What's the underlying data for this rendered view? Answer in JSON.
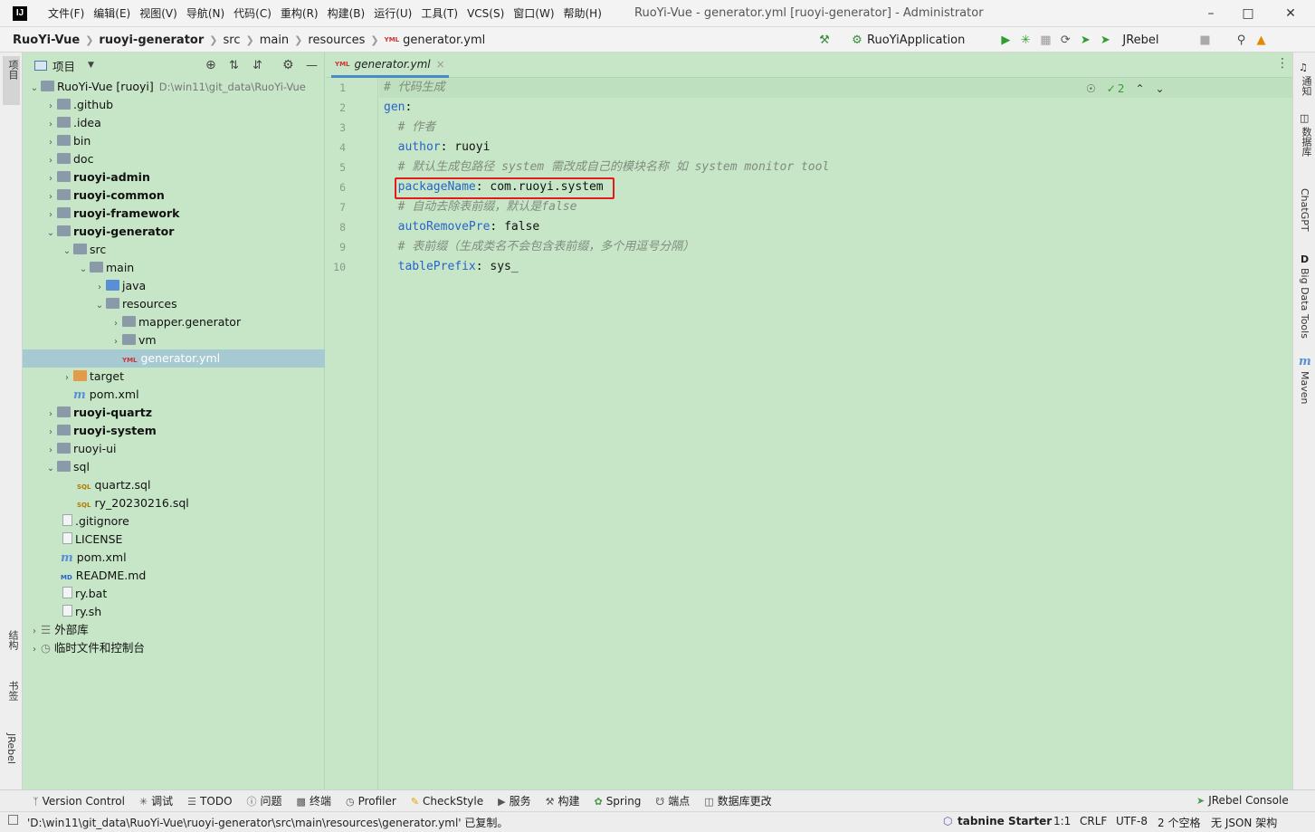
{
  "window": {
    "logo": "IJ",
    "title": "RuoYi-Vue - generator.yml [ruoyi-generator] - Administrator",
    "menu": [
      "文件(F)",
      "编辑(E)",
      "视图(V)",
      "导航(N)",
      "代码(C)",
      "重构(R)",
      "构建(B)",
      "运行(U)",
      "工具(T)",
      "VCS(S)",
      "窗口(W)",
      "帮助(H)"
    ]
  },
  "breadcrumb": [
    "RuoYi-Vue",
    "ruoyi-generator",
    "src",
    "main",
    "resources",
    "generator.yml"
  ],
  "toolbar": {
    "run_config": "RuoYiApplication",
    "jrebel": "JRebel"
  },
  "left_stripe": {
    "top": "项目",
    "structure": "结构",
    "bookmarks": "书签",
    "jrebel": "JRebel"
  },
  "right_stripe": [
    "通知",
    "数据库",
    "ChatGPT",
    "Big Data Tools",
    "Maven"
  ],
  "project_panel": {
    "title": "项目",
    "root_name": "RuoYi-Vue [ruoyi]",
    "root_path": "D:\\win11\\git_data\\RuoYi-Vue",
    "items": [
      ".github",
      ".idea",
      "bin",
      "doc",
      "ruoyi-admin",
      "ruoyi-common",
      "ruoyi-framework",
      "ruoyi-generator",
      "src",
      "main",
      "java",
      "resources",
      "mapper.generator",
      "vm",
      "generator.yml",
      "target",
      "pom.xml",
      "ruoyi-quartz",
      "ruoyi-system",
      "ruoyi-ui",
      "sql",
      "quartz.sql",
      "ry_20230216.sql",
      ".gitignore",
      "LICENSE",
      "pom.xml",
      "README.md",
      "ry.bat",
      "ry.sh",
      "外部库",
      "临时文件和控制台"
    ]
  },
  "editor": {
    "tab": "generator.yml",
    "inspection_count": "2",
    "lines": [
      {
        "n": "1",
        "comment": "# 代码生成"
      },
      {
        "n": "2",
        "key": "gen",
        "sep": ":"
      },
      {
        "n": "3",
        "comment": "  # 作者"
      },
      {
        "n": "4",
        "key": "  author",
        "sep": ": ",
        "value": "ruoyi"
      },
      {
        "n": "5",
        "comment": "  # 默认生成包路径 system 需改成自己的模块名称 如 system monitor tool"
      },
      {
        "n": "6",
        "key": "  packageName",
        "sep": ": ",
        "value": "com.ruoyi.system"
      },
      {
        "n": "7",
        "comment": "  # 自动去除表前缀，默认是false"
      },
      {
        "n": "8",
        "key": "  autoRemovePre",
        "sep": ": ",
        "value": "false"
      },
      {
        "n": "9",
        "comment": "  # 表前缀（生成类名不会包含表前缀，多个用逗号分隔）"
      },
      {
        "n": "10",
        "key": "  tablePrefix",
        "sep": ": ",
        "value": "sys_"
      }
    ]
  },
  "bottom_tools": [
    "Version Control",
    "调试",
    "TODO",
    "问题",
    "终端",
    "Profiler",
    "CheckStyle",
    "服务",
    "构建",
    "Spring",
    "端点",
    "数据库更改"
  ],
  "jrebel_console": "JRebel Console",
  "status": {
    "message": "'D:\\win11\\git_data\\RuoYi-Vue\\ruoyi-generator\\src\\main\\resources\\generator.yml' 已复制。",
    "tabnine": "tabnine Starter",
    "position": "1:1",
    "line_sep": "CRLF",
    "encoding": "UTF-8",
    "indent": "2 个空格",
    "schema": "无 JSON 架构"
  }
}
